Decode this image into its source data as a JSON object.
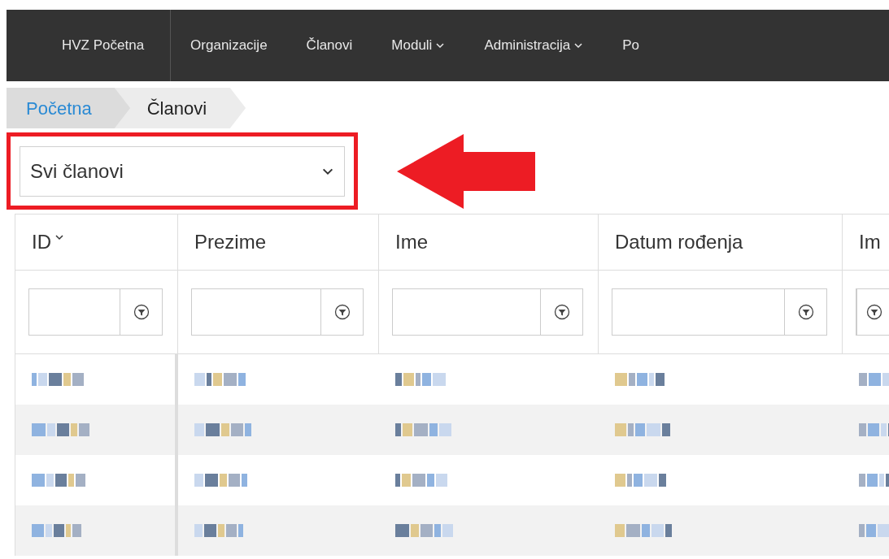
{
  "nav": {
    "items": [
      {
        "label": "HVZ Početna",
        "dropdown": false
      },
      {
        "label": "Organizacije",
        "dropdown": false
      },
      {
        "label": "Članovi",
        "dropdown": false
      },
      {
        "label": "Moduli",
        "dropdown": true
      },
      {
        "label": "Administracija",
        "dropdown": true
      },
      {
        "label": "Po",
        "dropdown": false
      }
    ]
  },
  "breadcrumb": [
    {
      "label": "Početna",
      "selected": false
    },
    {
      "label": "Članovi",
      "selected": true
    }
  ],
  "filter_select": {
    "value": "Svi članovi",
    "highlighted": true
  },
  "table": {
    "columns": [
      {
        "label": "ID",
        "sorted": true
      },
      {
        "label": "Prezime",
        "sorted": false
      },
      {
        "label": "Ime",
        "sorted": false
      },
      {
        "label": "Datum rođenja",
        "sorted": false
      },
      {
        "label": "Im",
        "sorted": false
      }
    ],
    "rows": [
      {
        "kind": "redacted"
      },
      {
        "kind": "redacted"
      },
      {
        "kind": "redacted"
      },
      {
        "kind": "redacted"
      }
    ]
  }
}
